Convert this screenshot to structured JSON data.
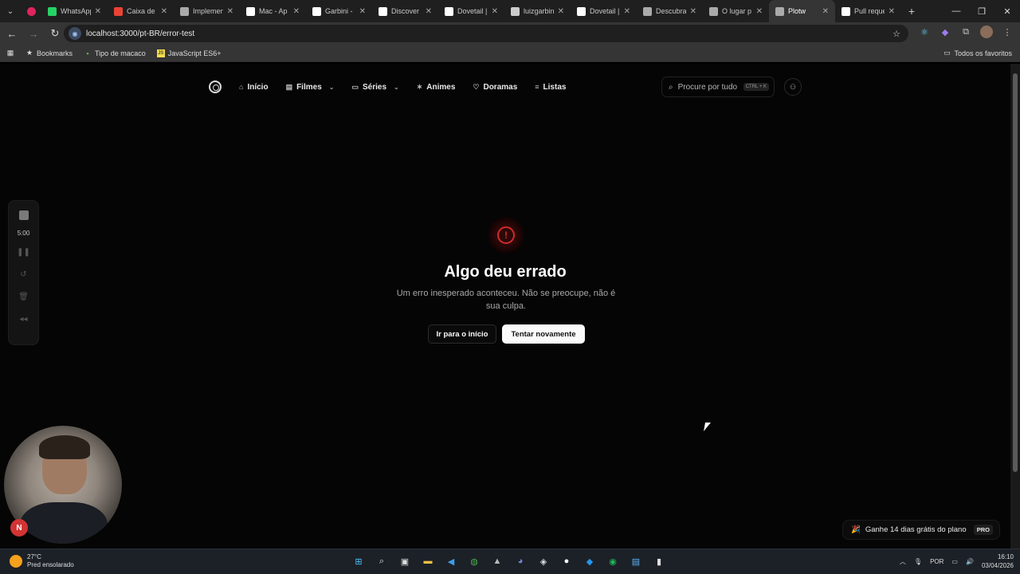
{
  "browser": {
    "tabs": [
      {
        "label": "WhatsApp",
        "color": "#25d366"
      },
      {
        "label": "Caixa de",
        "color": "#ea4335"
      },
      {
        "label": "Implemen",
        "color": "#aaaaaa"
      },
      {
        "label": "Mac - Ap",
        "color": "#ffffff"
      },
      {
        "label": "Garbini -",
        "color": "#ffffff"
      },
      {
        "label": "Discover",
        "color": "#ffffff"
      },
      {
        "label": "Dovetail |",
        "color": "#ffffff"
      },
      {
        "label": "luizgarbin",
        "color": "#cccccc"
      },
      {
        "label": "Dovetail |",
        "color": "#ffffff"
      },
      {
        "label": "Descubra",
        "color": "#aaaaaa"
      },
      {
        "label": "O lugar p",
        "color": "#aaaaaa"
      },
      {
        "label": "Plotw",
        "color": "#aaaaaa",
        "active": true
      },
      {
        "label": "Pull reque",
        "color": "#ffffff"
      }
    ],
    "url": "localhost:3000/pt-BR/error-test",
    "bookmarks": [
      {
        "label": "Bookmarks",
        "icon": "star-icon"
      },
      {
        "label": "Tipo de macaco",
        "icon": "mt-icon"
      },
      {
        "label": "JavaScript ES6+",
        "icon": "js-icon"
      }
    ],
    "bookmarks_right": "Todos os favoritos"
  },
  "site_nav": {
    "items": [
      {
        "label": "Início",
        "icon": "home-icon",
        "dropdown": false
      },
      {
        "label": "Filmes",
        "icon": "film-icon",
        "dropdown": true
      },
      {
        "label": "Séries",
        "icon": "tv-icon",
        "dropdown": true
      },
      {
        "label": "Animes",
        "icon": "sparkle-icon",
        "dropdown": false
      },
      {
        "label": "Doramas",
        "icon": "heart-icon",
        "dropdown": false
      },
      {
        "label": "Listas",
        "icon": "list-icon",
        "dropdown": false
      }
    ],
    "search_placeholder": "Procure por tudo",
    "search_shortcut": "CTRL + K"
  },
  "error": {
    "title": "Algo deu errado",
    "description": "Um erro inesperado aconteceu. Não se preocupe, não é sua culpa.",
    "home_button": "Ir para o início",
    "retry_button": "Tentar novamente"
  },
  "recorder": {
    "time": "5:00"
  },
  "camera_badge": "N",
  "promo": {
    "text": "Ganhe 14 dias grátis do plano",
    "badge": "PRO"
  },
  "taskbar": {
    "temperature": "27°C",
    "weather": "Pred ensolarado",
    "language": "POR",
    "time": "16:10",
    "date": "03/04/2026"
  }
}
